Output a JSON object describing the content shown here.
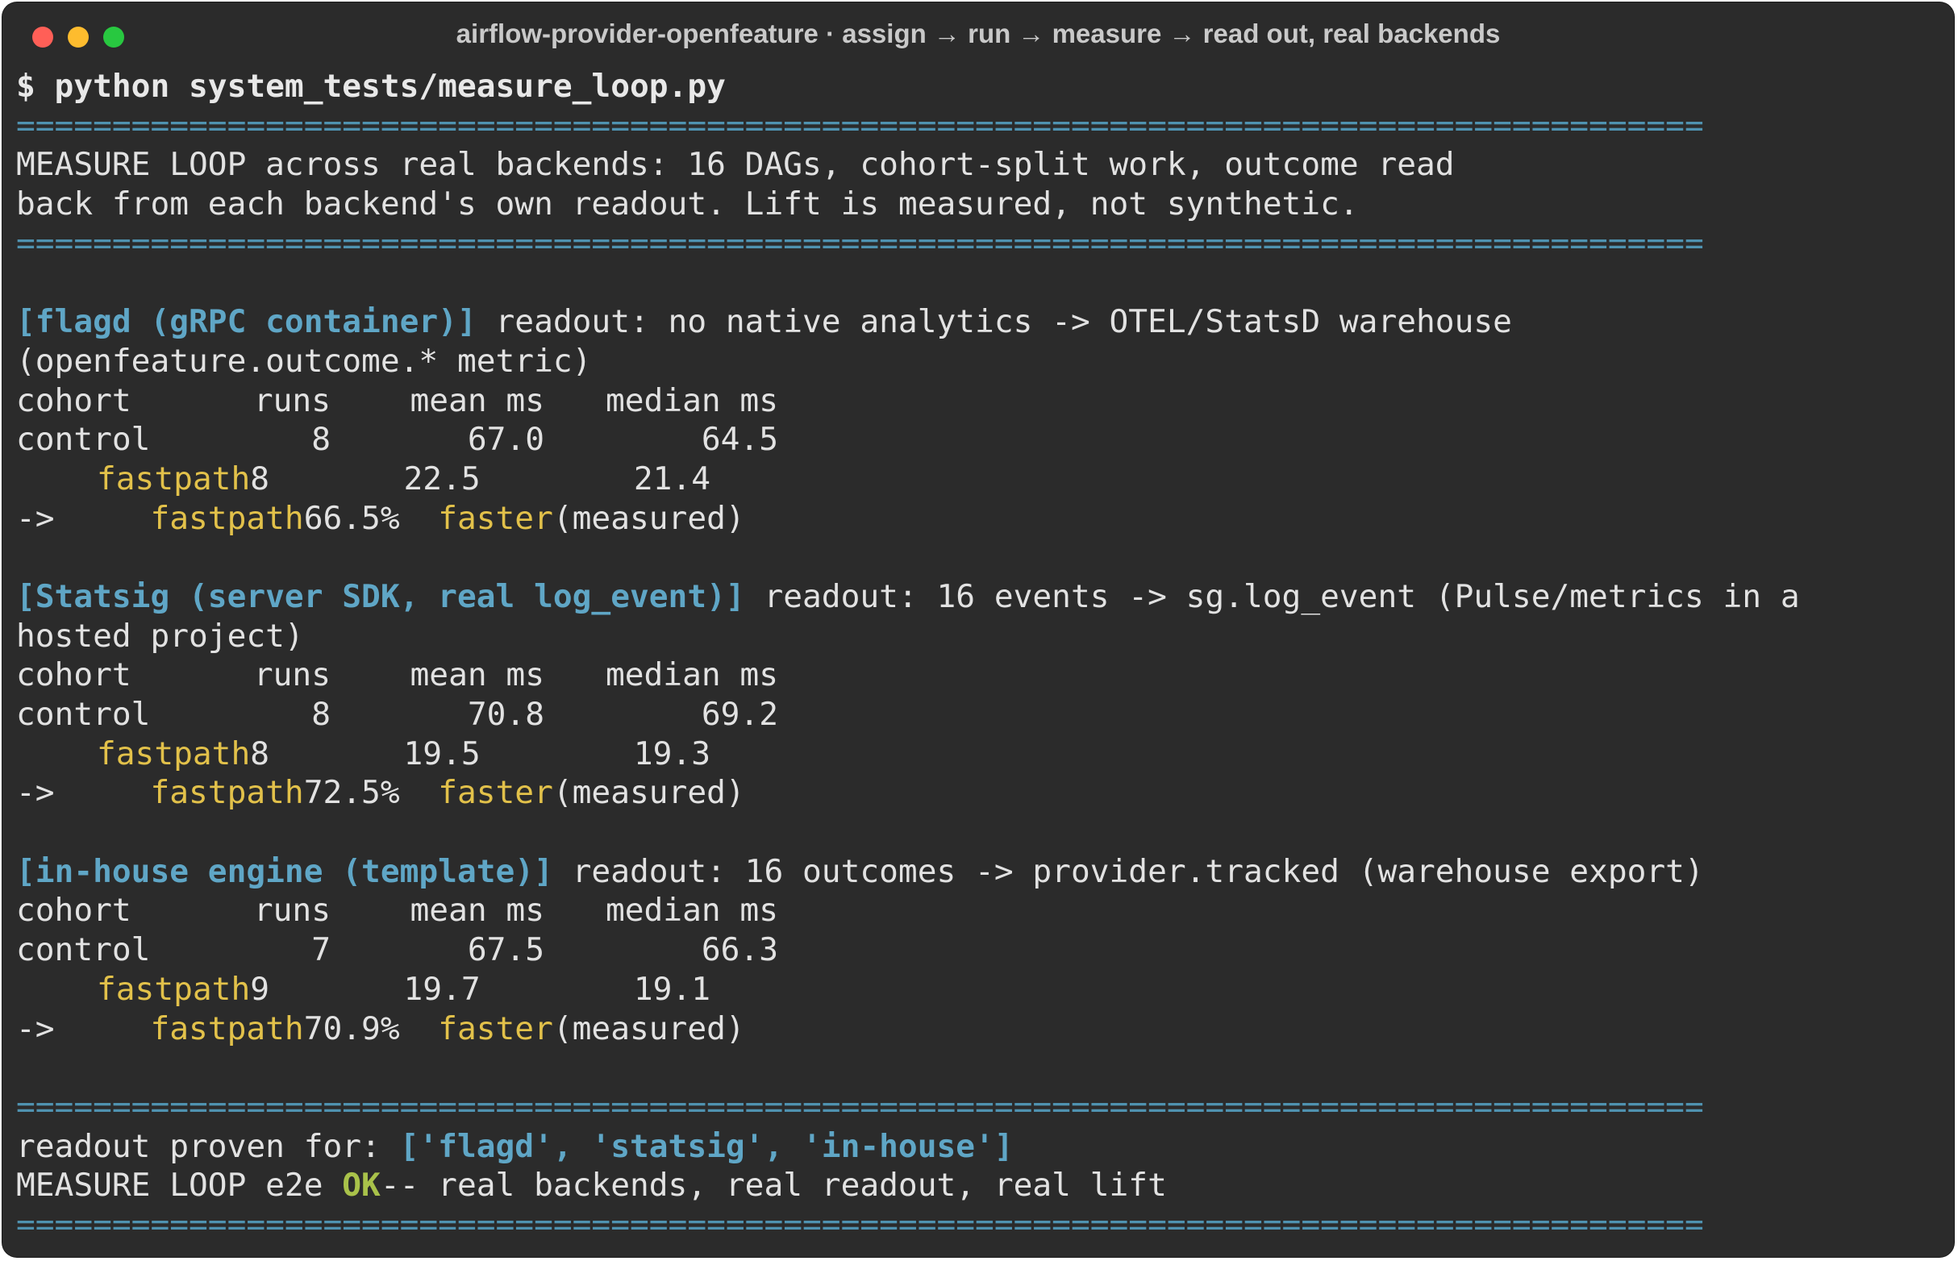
{
  "window": {
    "title": "airflow-provider-openfeature · assign → run → measure → read out, real backends"
  },
  "terminal": {
    "command": "$ python system_tests/measure_loop.py",
    "rule": "========================================================================================",
    "intro": [
      "MEASURE LOOP across real backends: 16 DAGs, cohort-split work, outcome read",
      "back from each backend's own readout. Lift is measured, not synthetic."
    ],
    "table_header": {
      "cohort": "cohort",
      "runs": "runs",
      "mean": "mean ms",
      "median": "median ms"
    },
    "arrow": "->",
    "faster_word": "faster",
    "measured_word": "(measured)",
    "backends": [
      {
        "name": "[flagd (gRPC container)]",
        "readout": " readout: no native analytics -> OTEL/StatsD warehouse",
        "readout_cont": "(openfeature.outcome.* metric)",
        "control": {
          "label": "control",
          "runs": "8",
          "mean": "67.0",
          "median": "64.5"
        },
        "fast": {
          "label": "fastpath",
          "runs": "8",
          "mean": "22.5",
          "median": "21.4"
        },
        "lift": {
          "label": "fastpath",
          "pct": "66.5%"
        }
      },
      {
        "name": "[Statsig (server SDK, real log_event)]",
        "readout": " readout: 16 events -> sg.log_event (Pulse/metrics in a",
        "readout_cont": "hosted project)",
        "control": {
          "label": "control",
          "runs": "8",
          "mean": "70.8",
          "median": "69.2"
        },
        "fast": {
          "label": "fastpath",
          "runs": "8",
          "mean": "19.5",
          "median": "19.3"
        },
        "lift": {
          "label": "fastpath",
          "pct": "72.5%"
        }
      },
      {
        "name": "[in-house engine (template)]",
        "readout": " readout: 16 outcomes -> provider.tracked (warehouse export)",
        "control": {
          "label": "control",
          "runs": "7",
          "mean": "67.5",
          "median": "66.3"
        },
        "fast": {
          "label": "fastpath",
          "runs": "9",
          "mean": "19.7",
          "median": "19.1"
        },
        "lift": {
          "label": "fastpath",
          "pct": "70.9%"
        }
      }
    ],
    "summary": {
      "proven_label": "readout proven for: ",
      "proven_list": "['flagd', 'statsig', 'in-house']",
      "loop_prefix": "MEASURE LOOP e2e ",
      "ok": "OK",
      "loop_suffix": "-- real backends, real readout, real lift"
    }
  }
}
